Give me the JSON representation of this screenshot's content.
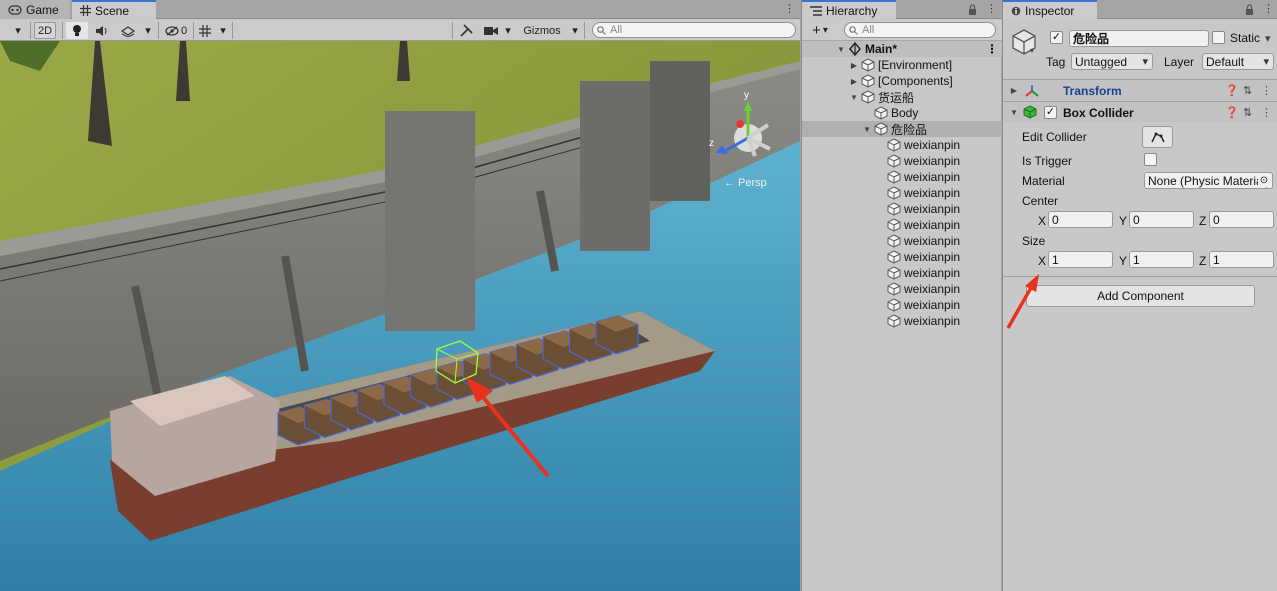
{
  "scene_panel": {
    "tabs": [
      {
        "label": "Game",
        "icon": "gamepad-icon"
      },
      {
        "label": "Scene",
        "icon": "grid-icon"
      }
    ],
    "toolbar": {
      "mode_2d": "2D",
      "hidden_count": "0",
      "gizmos_label": "Gizmos",
      "search_placeholder": "All"
    },
    "view_label": "← Persp",
    "gizmo_axes": {
      "y": "y",
      "z": "z"
    }
  },
  "hierarchy": {
    "tab_label": "Hierarchy",
    "search_placeholder": "All",
    "add_label": "+",
    "items": [
      {
        "label": "Main*",
        "depth": 0,
        "fold": "open",
        "type": "scene"
      },
      {
        "label": "[Environment]",
        "depth": 1,
        "fold": "closed",
        "type": "object"
      },
      {
        "label": "[Components]",
        "depth": 1,
        "fold": "closed",
        "type": "object"
      },
      {
        "label": "货运船",
        "depth": 1,
        "fold": "open",
        "type": "object"
      },
      {
        "label": "Body",
        "depth": 2,
        "fold": "none",
        "type": "object"
      },
      {
        "label": "危险品",
        "depth": 2,
        "fold": "open",
        "type": "object",
        "selected": true
      },
      {
        "label": "weixianpin",
        "depth": 3,
        "fold": "none",
        "type": "object"
      },
      {
        "label": "weixianpin",
        "depth": 3,
        "fold": "none",
        "type": "object"
      },
      {
        "label": "weixianpin",
        "depth": 3,
        "fold": "none",
        "type": "object"
      },
      {
        "label": "weixianpin",
        "depth": 3,
        "fold": "none",
        "type": "object"
      },
      {
        "label": "weixianpin",
        "depth": 3,
        "fold": "none",
        "type": "object"
      },
      {
        "label": "weixianpin",
        "depth": 3,
        "fold": "none",
        "type": "object"
      },
      {
        "label": "weixianpin",
        "depth": 3,
        "fold": "none",
        "type": "object"
      },
      {
        "label": "weixianpin",
        "depth": 3,
        "fold": "none",
        "type": "object"
      },
      {
        "label": "weixianpin",
        "depth": 3,
        "fold": "none",
        "type": "object"
      },
      {
        "label": "weixianpin",
        "depth": 3,
        "fold": "none",
        "type": "object"
      },
      {
        "label": "weixianpin",
        "depth": 3,
        "fold": "none",
        "type": "object"
      },
      {
        "label": "weixianpin",
        "depth": 3,
        "fold": "none",
        "type": "object"
      }
    ]
  },
  "inspector": {
    "tab_label": "Inspector",
    "object_name": "危险品",
    "static_label": "Static",
    "tag_label": "Tag",
    "tag_value": "Untagged",
    "layer_label": "Layer",
    "layer_value": "Default",
    "transform_title": "Transform",
    "box_collider": {
      "title": "Box Collider",
      "edit_collider_label": "Edit Collider",
      "is_trigger_label": "Is Trigger",
      "material_label": "Material",
      "material_value": "None (Physic Material)",
      "center_label": "Center",
      "center": {
        "x": "0",
        "y": "0",
        "z": "0"
      },
      "size_label": "Size",
      "size": {
        "x": "1",
        "y": "1",
        "z": "1"
      },
      "axis_labels": {
        "x": "X",
        "y": "Y",
        "z": "Z"
      }
    },
    "add_component_label": "Add Component"
  },
  "colors": {
    "accent_blue": "#3a72d6",
    "annotation_red": "#e8321e",
    "selection_green": "#9cff3a",
    "water": "#3b8eb6",
    "grass": "#8a9a3a"
  }
}
